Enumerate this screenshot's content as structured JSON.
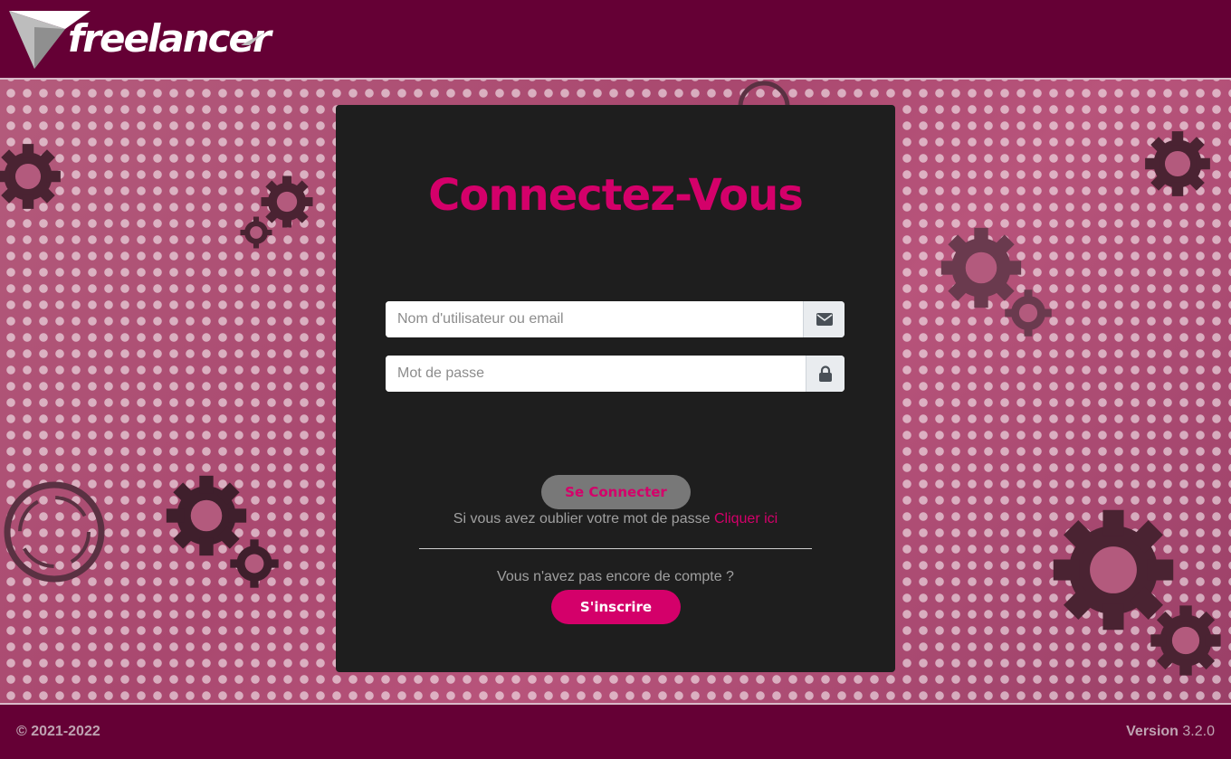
{
  "header": {
    "brand": "freelancer"
  },
  "login": {
    "title": "Connectez-Vous",
    "username_placeholder": "Nom d'utilisateur ou email",
    "password_placeholder": "Mot de passe",
    "username_icon": "envelope-icon",
    "password_icon": "lock-icon",
    "submit_label": "Se Connecter",
    "forgot_text": "Si vous avez oublier votre mot de passe",
    "forgot_link": "Cliquer ici",
    "no_account_text": "Vous n'avez pas encore de compte ?",
    "signup_label": "S'inscrire"
  },
  "footer": {
    "copyright": "© 2021-2022",
    "version_label": "Version",
    "version_number": "3.2.0"
  },
  "colors": {
    "brand": "#650035",
    "accent": "#d4006a",
    "card": "#1e1e1e"
  }
}
